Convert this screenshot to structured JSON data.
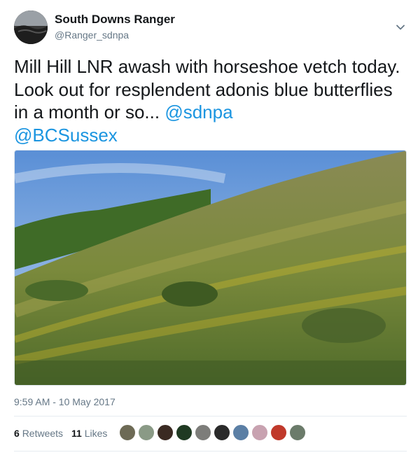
{
  "user": {
    "display_name": "South Downs Ranger",
    "handle": "@Ranger_sdnpa",
    "avatar_label": "avatar"
  },
  "tweet": {
    "text": "Mill Hill LNR awash with horseshoe vetch today. Look out for resplendent adonis blue butterflies in a month or so... ",
    "mentions": [
      "@sdnpa",
      "@BCSussex"
    ],
    "timestamp": "9:59 AM - 10 May 2017"
  },
  "stats": {
    "retweets_count": "6",
    "retweets_label": "Retweets",
    "likes_count": "11",
    "likes_label": "Likes"
  },
  "likers": [
    {
      "color": "#6d6a55"
    },
    {
      "color": "#8a9a86"
    },
    {
      "color": "#3a2a22"
    },
    {
      "color": "#1f3a22"
    },
    {
      "color": "#7d7d7a"
    },
    {
      "color": "#2a2a2a"
    },
    {
      "color": "#5b7fa5"
    },
    {
      "color": "#c8a2b0"
    },
    {
      "color": "#c0392b"
    },
    {
      "color": "#6b7b6a"
    }
  ],
  "colors": {
    "link": "#1b95e0",
    "text": "#14171a",
    "muted": "#657786"
  }
}
